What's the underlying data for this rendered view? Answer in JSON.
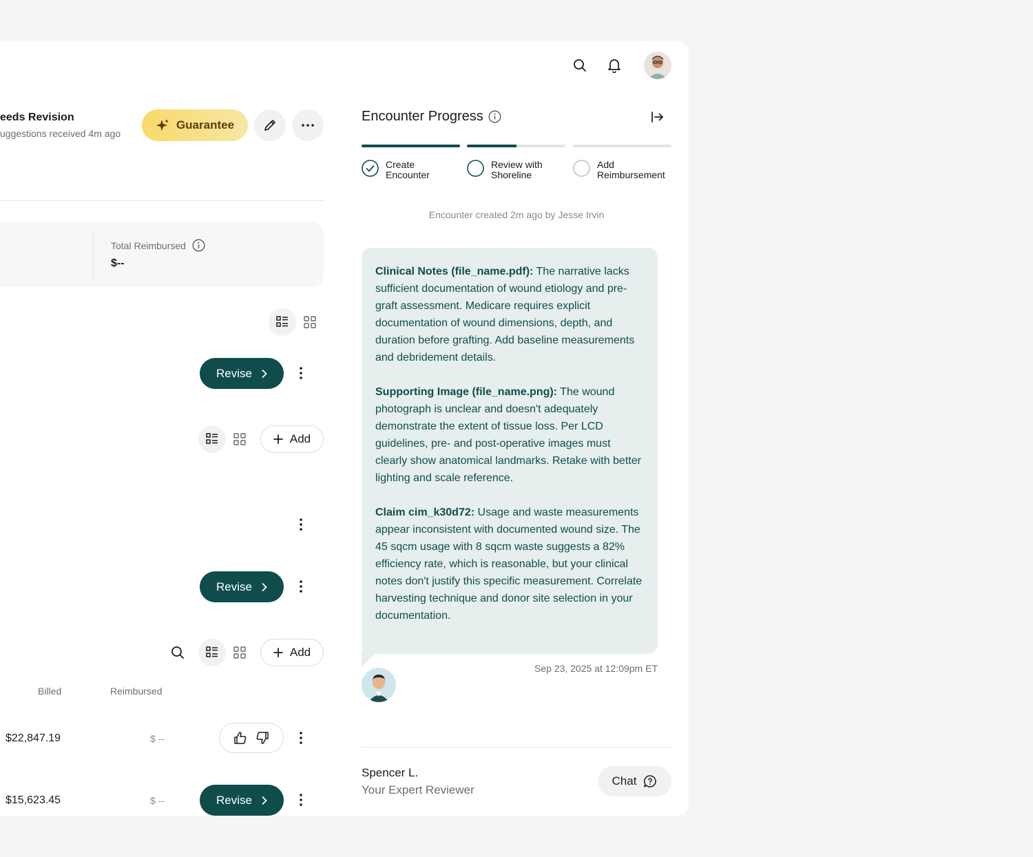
{
  "left": {
    "status_title": "eeds Revision",
    "status_sub": "uggestions received 4m ago",
    "guarantee_label": "Guarantee",
    "total_reimbursed_label": "Total Reimbursed",
    "total_reimbursed_value": "$--",
    "revise_label": "Revise",
    "add_label": "Add",
    "table": {
      "col_billed": "Billed",
      "col_reimbursed": "Reimbursed",
      "rows": [
        {
          "billed": "$22,847.19",
          "reimbursed": "$ --"
        },
        {
          "billed": "$15,623.45",
          "reimbursed": "$ --"
        }
      ]
    }
  },
  "panel": {
    "title": "Encounter Progress",
    "steps": [
      {
        "line1": "Create",
        "line2": "Encounter",
        "done": true,
        "progress": 1.0
      },
      {
        "line1": "Review with",
        "line2": "Shoreline",
        "done": false,
        "progress": 0.5
      },
      {
        "line1": "Add",
        "line2": "Reimbursement",
        "done": false,
        "progress": 0.0
      }
    ],
    "created_note": "Encounter created 2m ago by Jesse Irvin",
    "message": {
      "p1_bold": "Clinical Notes (file_name.pdf):",
      "p1_text": " The narrative lacks sufficient documentation of wound etiology and pre-graft assessment. Medicare requires explicit documentation of wound dimensions, depth, and duration before grafting. Add baseline measurements and debridement details.",
      "p2_bold": "Supporting Image (file_name.png):",
      "p2_text": " The wound photograph is unclear and doesn't adequately demonstrate the extent of tissue loss. Per LCD guidelines, pre- and post-operative images must clearly show anatomical landmarks. Retake with better lighting and scale reference.",
      "p3_bold": "Claim cim_k30d72:",
      "p3_text": " Usage and waste measurements appear inconsistent with documented wound size. The 45 sqcm usage with 8 sqcm waste suggests a 82% efficiency rate, which is reasonable, but your clinical notes don't justify this specific measurement. Correlate harvesting technique and donor site selection in your documentation."
    },
    "timestamp": "Sep 23, 2025 at 12:09pm ET",
    "reviewer_name": "Spencer L.",
    "reviewer_role": "Your Expert Reviewer",
    "chat_label": "Chat"
  },
  "colors": {
    "primary": "#0f4d4b",
    "bubble_bg": "#e6efee",
    "guarantee_from": "#f8d96a",
    "guarantee_to": "#f7e7a4"
  },
  "icons": [
    "search-icon",
    "bell-icon",
    "sparkle-icon",
    "pencil-icon",
    "more-horizontal-icon",
    "info-icon",
    "list-view-icon",
    "grid-view-icon",
    "chevron-right-icon",
    "more-vertical-icon",
    "plus-icon",
    "thumbs-up-icon",
    "thumbs-down-icon",
    "collapse-panel-icon",
    "check-circle-icon",
    "chat-icon"
  ]
}
